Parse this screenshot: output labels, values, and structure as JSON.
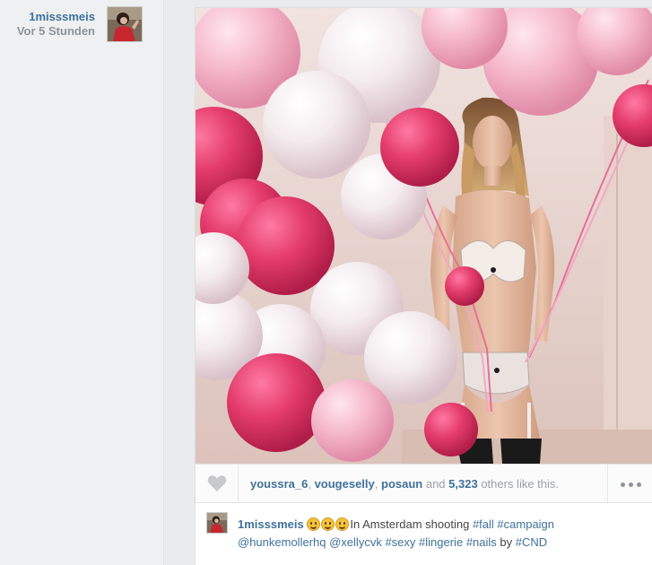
{
  "sidebar": {
    "author_name": "1misssmeis",
    "posted_time": "Vor 5 Stunden"
  },
  "post": {
    "likes": {
      "users": [
        "youssra_6",
        "vougeselly",
        "posaun"
      ],
      "sep1": ", ",
      "sep2": ", ",
      "and_word": " and ",
      "count": "5,323",
      "suffix": " others like this."
    },
    "caption": {
      "user": "1misssmeis",
      "emoji_count": 3,
      "text_1": "In Amsterdam shooting ",
      "tag_fall": "#fall",
      "tag_campaign": "#campaign",
      "mention_1": "@hunkemollerhq",
      "mention_2": "@xellycvk",
      "tag_sexy": "#sexy",
      "tag_lingerie": "#lingerie",
      "tag_nails": "#nails",
      "by_word": " by ",
      "tag_cnd": "#CND"
    }
  },
  "colors": {
    "link_blue": "#3f729b",
    "muted_gray": "#8e9499",
    "balloon_pink": "#e24f7c"
  },
  "icons": {
    "like": "heart-icon",
    "more": "more-options-icon"
  }
}
